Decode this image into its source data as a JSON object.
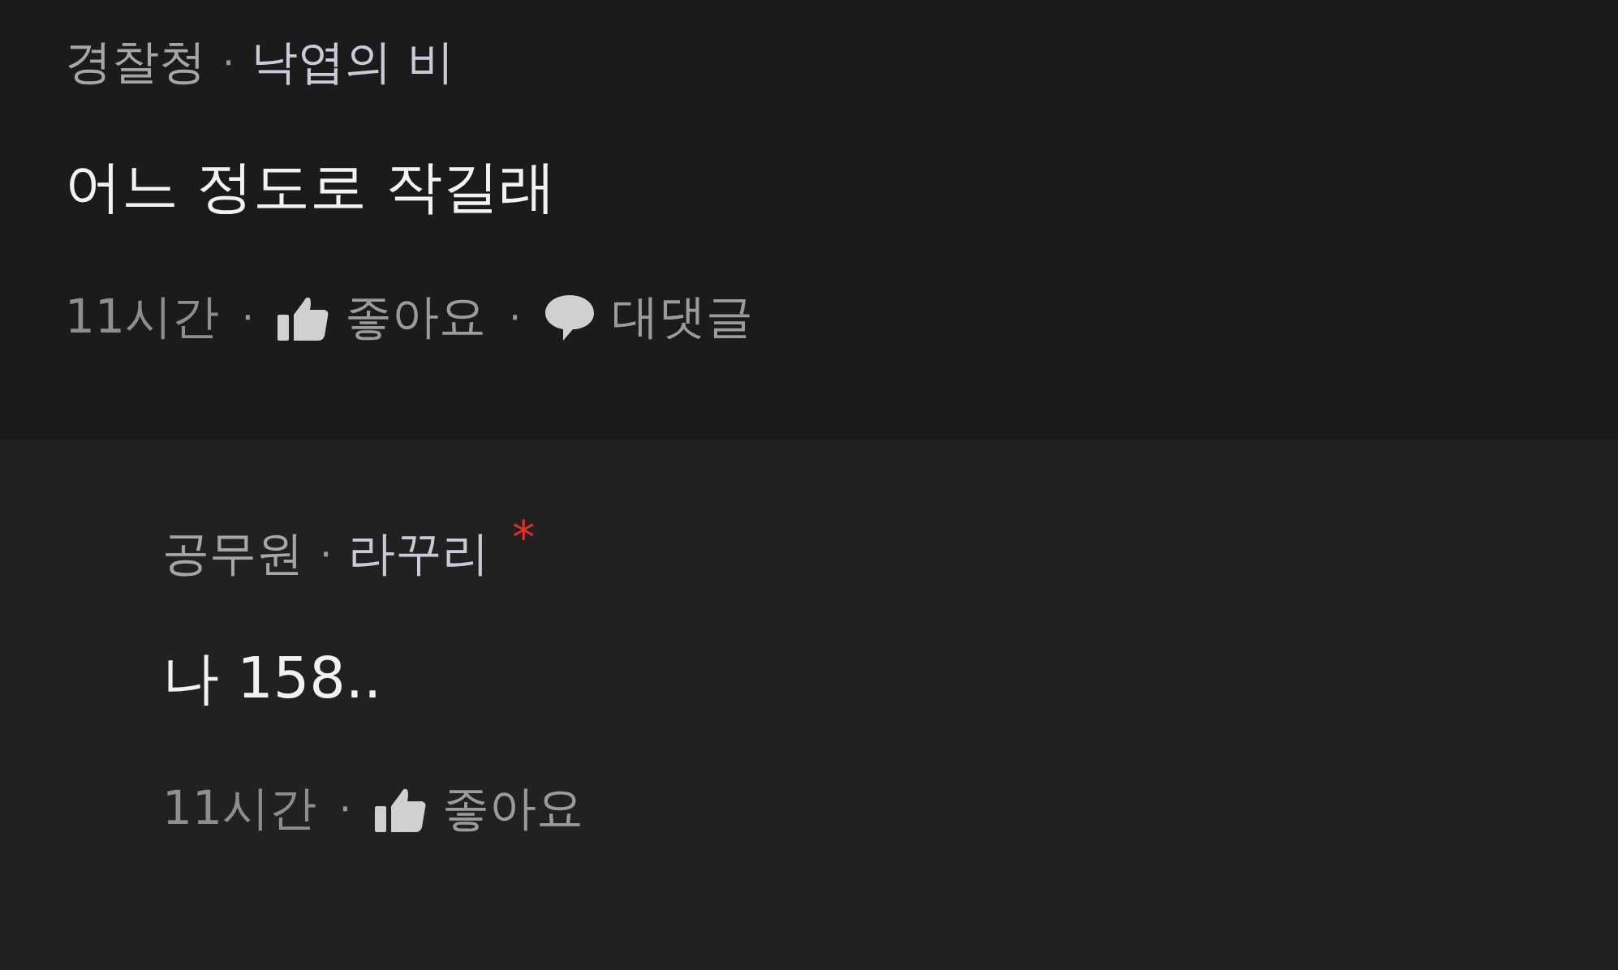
{
  "comments": [
    {
      "kind": "comment",
      "company": "경찰청",
      "separator": "·",
      "nickname": "낙엽의 비",
      "body": "어느 정도로 작길래",
      "time": "11시간",
      "like_label": "좋아요",
      "reply_label": "대댓글"
    },
    {
      "kind": "reply",
      "company": "공무원",
      "separator": "·",
      "nickname": "라꾸리",
      "badge": "*",
      "body": "나 158..",
      "time": "11시간",
      "like_label": "좋아요"
    }
  ]
}
